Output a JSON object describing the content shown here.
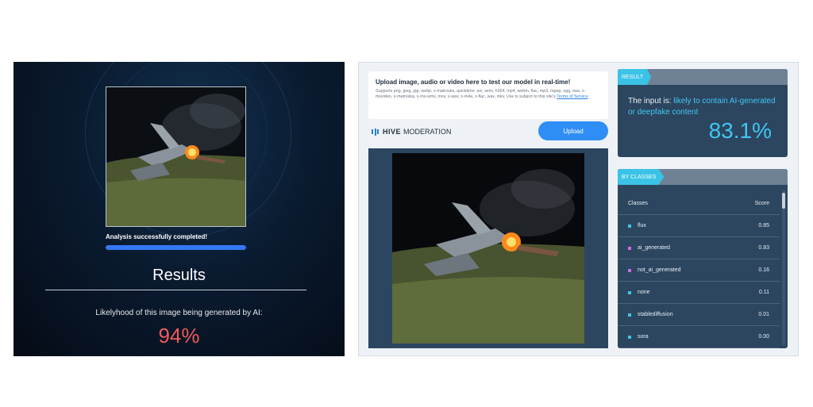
{
  "left": {
    "status": "Analysis successfully completed!",
    "progress_fraction": 1.0,
    "results_title": "Results",
    "likelihood_label": "Likelyhood of this image being generated by AI:",
    "likelihood_value": "94%",
    "colors": {
      "accent": "#f15a5a",
      "progress": "#3478f6",
      "background": "#050b16"
    }
  },
  "right": {
    "upload": {
      "title": "Upload image, audio or video here to test our model in real-time!",
      "supports": "Supports png, jpeg, jpg, webp, x-matroska, quicktime, avi, wmv, h264, mp4, webm, flac, mp3, mpeg, ogg, wav, x-msvideo, x-matroska, x-ms-wmv, mov, x-wav, x-m4a, x-flac, wav, mkv. Use is subject to this site's",
      "tos_link": "Terms of Service",
      "button_label": "Upload"
    },
    "logo": {
      "brand": "HIVE",
      "product": "MODERATION"
    },
    "result": {
      "tag": "RESULT",
      "prefix": "The input is:",
      "verdict": "likely to contain AI-generated or deepfake content",
      "percent": "83.1%"
    },
    "classes": {
      "tag": "BY CLASSES",
      "header_class": "Classes",
      "header_score": "Score",
      "rows": [
        {
          "name": "flux",
          "score": "0.85",
          "color": "#3ec6e0"
        },
        {
          "name": "ai_generated",
          "score": "0.83",
          "color": "#c86ee0"
        },
        {
          "name": "not_ai_generated",
          "score": "0.16",
          "color": "#c86ee0"
        },
        {
          "name": "none",
          "score": "0.11",
          "color": "#3ec6e0"
        },
        {
          "name": "stablediffusion",
          "score": "0.01",
          "color": "#3ec6e0"
        },
        {
          "name": "sora",
          "score": "0.00",
          "color": "#3ec6e0"
        }
      ]
    },
    "colors": {
      "accent": "#41c6f0",
      "tag": "#3ac3e6",
      "button": "#2f8ef5",
      "card": "#2c4660"
    }
  }
}
